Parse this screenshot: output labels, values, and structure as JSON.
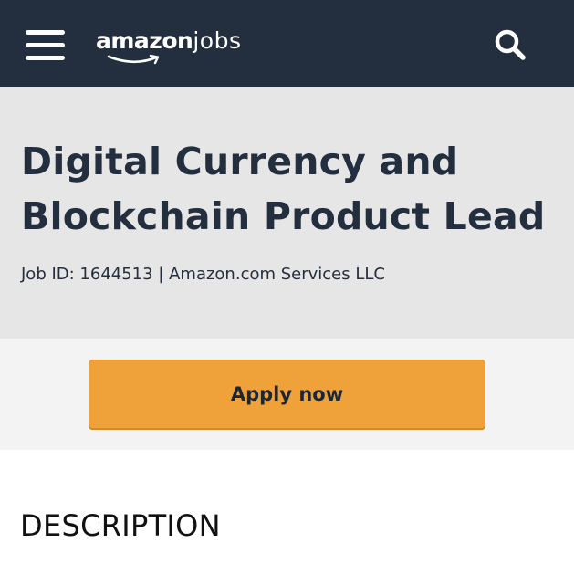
{
  "header": {
    "logo_primary": "amazon",
    "logo_secondary": "jobs",
    "menu_icon": "hamburger-menu-icon",
    "search_icon": "search-icon",
    "background_color": "#232f3e"
  },
  "job": {
    "title": "Digital Currency and Blockchain Product Lead",
    "meta": "Job ID: 1644513 | Amazon.com Services LLC"
  },
  "apply": {
    "label": "Apply now",
    "button_color": "#f0a23a"
  },
  "description": {
    "heading": "DESCRIPTION"
  }
}
